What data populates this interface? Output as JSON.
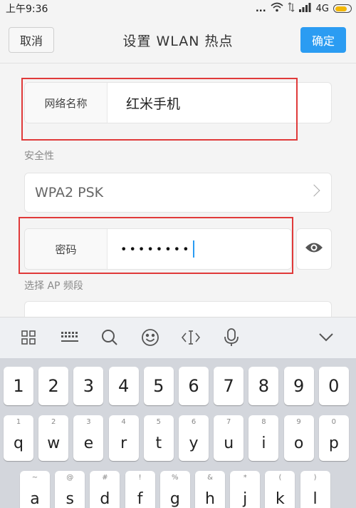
{
  "status_bar": {
    "time": "上午9:36",
    "dots": "...",
    "signal_text": "4G",
    "battery_level": 0.8
  },
  "titlebar": {
    "cancel_label": "取消",
    "title": "设置 WLAN 热点",
    "confirm_label": "确定"
  },
  "form": {
    "network_name": {
      "label": "网络名称",
      "value": "红米手机"
    },
    "security": {
      "section_label": "安全性",
      "value": "WPA2 PSK"
    },
    "password": {
      "label": "密码",
      "value": "••••••••"
    },
    "ap_band": {
      "section_label": "选择 AP 频段"
    }
  },
  "keyboard_toolbar": {
    "icons": [
      "grid-icon",
      "keyboard-icon",
      "search-icon",
      "emoji-icon",
      "cursor-icon",
      "microphone-icon",
      "collapse-icon"
    ]
  },
  "keyboard": {
    "number_row": [
      "1",
      "2",
      "3",
      "4",
      "5",
      "6",
      "7",
      "8",
      "9",
      "0"
    ],
    "letter_row_1": [
      {
        "sub": "1",
        "key": "q"
      },
      {
        "sub": "2",
        "key": "w"
      },
      {
        "sub": "3",
        "key": "e"
      },
      {
        "sub": "4",
        "key": "r"
      },
      {
        "sub": "5",
        "key": "t"
      },
      {
        "sub": "6",
        "key": "y"
      },
      {
        "sub": "7",
        "key": "u"
      },
      {
        "sub": "8",
        "key": "i"
      },
      {
        "sub": "9",
        "key": "o"
      },
      {
        "sub": "0",
        "key": "p"
      }
    ],
    "letter_row_2": [
      {
        "sub": "~",
        "key": "a"
      },
      {
        "sub": "@",
        "key": "s"
      },
      {
        "sub": "#",
        "key": "d"
      },
      {
        "sub": "!",
        "key": "f"
      },
      {
        "sub": "%",
        "key": "g"
      },
      {
        "sub": "&",
        "key": "h"
      },
      {
        "sub": "*",
        "key": "j"
      },
      {
        "sub": "(",
        "key": "k"
      },
      {
        "sub": ")",
        "key": "l"
      }
    ]
  },
  "colors": {
    "accent": "#2b9cf2",
    "highlight": "#e03a3a"
  }
}
